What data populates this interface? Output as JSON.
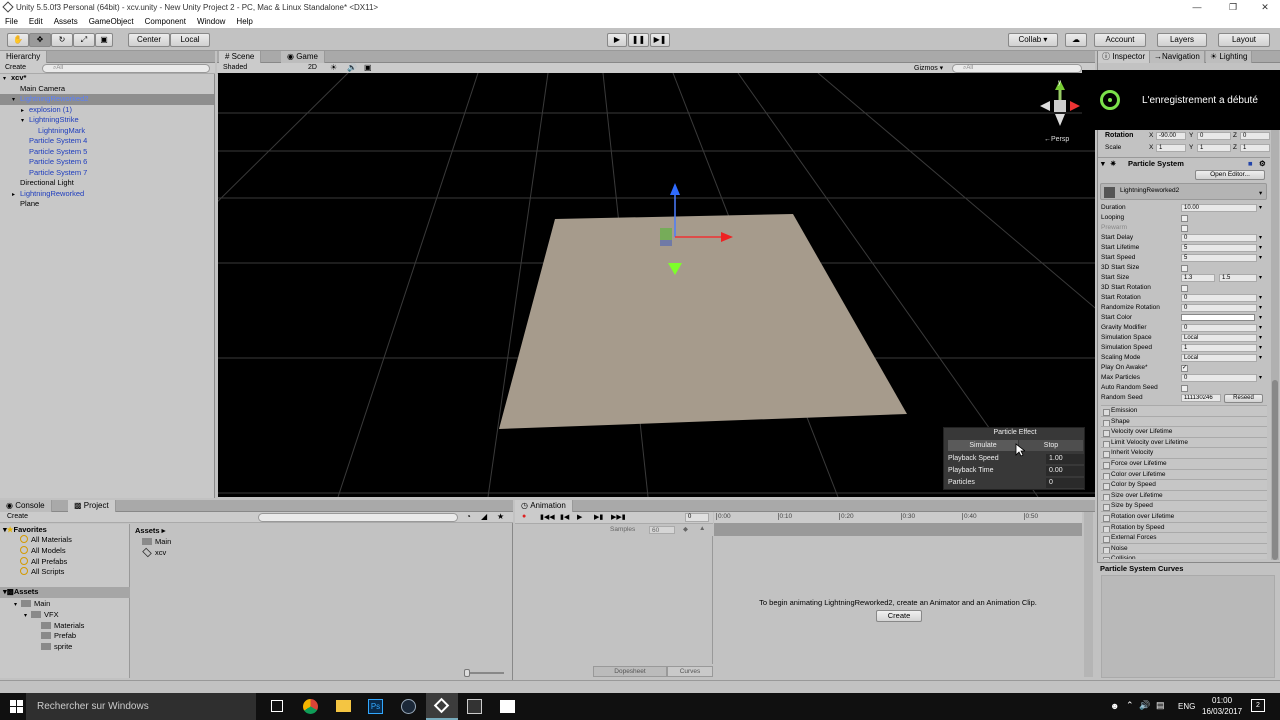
{
  "window": {
    "title": "Unity 5.5.0f3 Personal (64bit) - xcv.unity - New Unity Project 2 - PC, Mac & Linux Standalone* <DX11>"
  },
  "menu": [
    "File",
    "Edit",
    "Assets",
    "GameObject",
    "Component",
    "Window",
    "Help"
  ],
  "toolbar": {
    "center": "Center",
    "local": "Local",
    "collab": "Collab ▾",
    "account": "Account",
    "layers": "Layers",
    "layout": "Layout"
  },
  "hierarchy": {
    "tab": "Hierarchy",
    "create": "Create",
    "search": "⌕All",
    "items": [
      {
        "label": "xcv*",
        "indent": 0,
        "blue": false,
        "arrow": "▾",
        "bold": true
      },
      {
        "label": "Main Camera",
        "indent": 1,
        "blue": false,
        "arrow": ""
      },
      {
        "label": "LightningReworked2",
        "indent": 1,
        "blue": true,
        "arrow": "▾",
        "selected": true
      },
      {
        "label": "explosion (1)",
        "indent": 2,
        "blue": true,
        "arrow": "▸"
      },
      {
        "label": "LightningStrike",
        "indent": 2,
        "blue": true,
        "arrow": "▾"
      },
      {
        "label": "LightningMark",
        "indent": 3,
        "blue": true,
        "arrow": ""
      },
      {
        "label": "Particle System 4",
        "indent": 2,
        "blue": true,
        "arrow": ""
      },
      {
        "label": "Particle System 5",
        "indent": 2,
        "blue": true,
        "arrow": ""
      },
      {
        "label": "Particle System 6",
        "indent": 2,
        "blue": true,
        "arrow": ""
      },
      {
        "label": "Particle System 7",
        "indent": 2,
        "blue": true,
        "arrow": ""
      },
      {
        "label": "Directional Light",
        "indent": 1,
        "blue": false,
        "arrow": ""
      },
      {
        "label": "LightningReworked",
        "indent": 1,
        "blue": true,
        "arrow": "▸"
      },
      {
        "label": "Plane",
        "indent": 1,
        "blue": false,
        "arrow": ""
      }
    ]
  },
  "scene": {
    "tab_scene": "Scene",
    "tab_game": "Game",
    "shaded": "Shaded",
    "mode2d": "2D",
    "gizmos": "Gizmos ▾",
    "search": "⌕All",
    "persp": "←Persp"
  },
  "particle_effect": {
    "title": "Particle Effect",
    "simulate": "Simulate",
    "stop": "Stop",
    "rows": [
      {
        "k": "Playback Speed",
        "v": "1.00"
      },
      {
        "k": "Playback Time",
        "v": "0.00"
      },
      {
        "k": "Particles",
        "v": "0"
      }
    ]
  },
  "inspector": {
    "tabs": [
      "Inspector",
      "Navigation",
      "Lighting"
    ],
    "rotation": {
      "label": "Rotation",
      "x": "-90.00",
      "y": "0",
      "z": "0"
    },
    "scale": {
      "label": "Scale",
      "x": "1",
      "y": "1",
      "z": "1"
    },
    "component": "Particle System",
    "open_editor": "Open Editor...",
    "system_name": "LightningReworked2",
    "props": [
      {
        "k": "Duration",
        "v": "10.00",
        "t": "field"
      },
      {
        "k": "Looping",
        "v": "",
        "t": "check"
      },
      {
        "k": "Prewarm",
        "v": "",
        "t": "check",
        "dim": true
      },
      {
        "k": "Start Delay",
        "v": "0",
        "t": "field"
      },
      {
        "k": "Start Lifetime",
        "v": "5",
        "t": "field"
      },
      {
        "k": "Start Speed",
        "v": "5",
        "t": "field"
      },
      {
        "k": "3D Start Size",
        "v": "",
        "t": "check"
      },
      {
        "k": "Start Size",
        "v": "1.3",
        "v2": "1.5",
        "t": "two"
      },
      {
        "k": "3D Start Rotation",
        "v": "",
        "t": "check"
      },
      {
        "k": "Start Rotation",
        "v": "0",
        "t": "field"
      },
      {
        "k": "Randomize Rotation",
        "v": "0",
        "t": "field"
      },
      {
        "k": "Start Color",
        "v": "",
        "t": "color"
      },
      {
        "k": "Gravity Modifier",
        "v": "0",
        "t": "field"
      },
      {
        "k": "Simulation Space",
        "v": "Local",
        "t": "field"
      },
      {
        "k": "Simulation Speed",
        "v": "1",
        "t": "field"
      },
      {
        "k": "Scaling Mode",
        "v": "Local",
        "t": "field"
      },
      {
        "k": "Play On Awake*",
        "v": "✓",
        "t": "check"
      },
      {
        "k": "Max Particles",
        "v": "0",
        "t": "field"
      },
      {
        "k": "Auto Random Seed",
        "v": "",
        "t": "check"
      },
      {
        "k": "Random Seed",
        "v": "111130246",
        "t": "seed"
      }
    ],
    "reseed": "Reseed",
    "modules": [
      "Emission",
      "Shape",
      "Velocity over Lifetime",
      "Limit Velocity over Lifetime",
      "Inherit Velocity",
      "Force over Lifetime",
      "Color over Lifetime",
      "Color by Speed",
      "Size over Lifetime",
      "Size by Speed",
      "Rotation over Lifetime",
      "Rotation by Speed",
      "External Forces",
      "Noise",
      "Collision"
    ],
    "curves": "Particle System Curves"
  },
  "notification": {
    "text": "L'enregistrement a débuté"
  },
  "project": {
    "tab_console": "Console",
    "tab_project": "Project",
    "create": "Create",
    "favorites": "Favorites",
    "fav_items": [
      "All Materials",
      "All Models",
      "All Prefabs",
      "All Scripts"
    ],
    "assets_root": "Assets",
    "tree": [
      {
        "label": "Main",
        "indent": 1
      },
      {
        "label": "VFX",
        "indent": 2
      },
      {
        "label": "Materials",
        "indent": 3
      },
      {
        "label": "Prefab",
        "indent": 3
      },
      {
        "label": "sprite",
        "indent": 3
      }
    ],
    "breadcrumb": "Assets ▸",
    "files": [
      "Main",
      "xcv"
    ]
  },
  "animation": {
    "tab": "Animation",
    "samples_label": "Samples",
    "samples": "60",
    "ticks": [
      "0:00",
      "0:10",
      "0:20",
      "0:30",
      "0:40",
      "0:50"
    ],
    "message": "To begin animating LightningReworked2, create an Animator and an Animation Clip.",
    "create": "Create",
    "dopesheet": "Dopesheet",
    "curves": "Curves"
  },
  "taskbar": {
    "search": "Rechercher sur Windows",
    "time": "01:00",
    "date": "16/03/2017",
    "lang": "ENG",
    "notif": "2"
  }
}
